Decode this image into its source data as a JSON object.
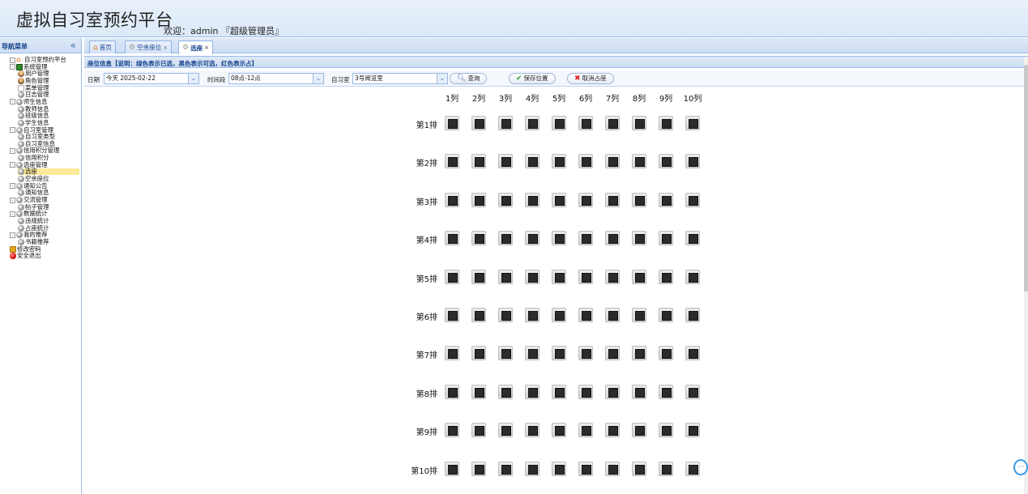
{
  "header": {
    "title": "虚拟自习室预约平台",
    "welcome": "欢迎：admin 『超级管理员』"
  },
  "sidebar": {
    "title": "导航菜单",
    "collapse_icon": "«",
    "items": [
      {
        "label": "自习室预约平台",
        "icon": "home-icon",
        "expander": "⊟"
      },
      {
        "label": "系统管理",
        "icon": "system-icon",
        "expander": "⊟"
      },
      {
        "label": "用户管理",
        "icon": "user-icon"
      },
      {
        "label": "角色管理",
        "icon": "role-icon"
      },
      {
        "label": "菜单管理",
        "icon": "menu-icon"
      },
      {
        "label": "日志管理",
        "icon": "gear-icon"
      },
      {
        "label": "师生信息",
        "icon": "gear-icon",
        "expander": "⊟"
      },
      {
        "label": "教师信息",
        "icon": "gear-icon"
      },
      {
        "label": "班级信息",
        "icon": "gear-icon"
      },
      {
        "label": "学生信息",
        "icon": "gear-icon"
      },
      {
        "label": "自习室管理",
        "icon": "gear-icon",
        "expander": "⊟"
      },
      {
        "label": "自习室类型",
        "icon": "gear-icon"
      },
      {
        "label": "自习室信息",
        "icon": "gear-icon"
      },
      {
        "label": "信用积分管理",
        "icon": "gear-icon",
        "expander": "⊟"
      },
      {
        "label": "信用积分",
        "icon": "gear-icon"
      },
      {
        "label": "选座管理",
        "icon": "gear-icon",
        "expander": "⊟"
      },
      {
        "label": "选座",
        "icon": "gear-icon",
        "selected": true
      },
      {
        "label": "空余座位",
        "icon": "gear-icon"
      },
      {
        "label": "通知公告",
        "icon": "gear-icon",
        "expander": "⊟"
      },
      {
        "label": "通知信息",
        "icon": "gear-icon"
      },
      {
        "label": "交流管理",
        "icon": "gear-icon",
        "expander": "⊟"
      },
      {
        "label": "帖子管理",
        "icon": "gear-icon"
      },
      {
        "label": "数据统计",
        "icon": "gear-icon",
        "expander": "⊟"
      },
      {
        "label": "违规统计",
        "icon": "gear-icon"
      },
      {
        "label": "占座统计",
        "icon": "gear-icon"
      },
      {
        "label": "我的推荐",
        "icon": "gear-icon",
        "expander": "⊟"
      },
      {
        "label": "书籍推荐",
        "icon": "gear-icon"
      },
      {
        "label": "修改密码",
        "icon": "lock-icon"
      },
      {
        "label": "安全退出",
        "icon": "exit-icon"
      }
    ]
  },
  "tabs": [
    {
      "label": "首页",
      "icon": "home-icon",
      "closable": false
    },
    {
      "label": "空余座位",
      "icon": "gear-icon",
      "closable": true
    },
    {
      "label": "选座",
      "icon": "gear-icon",
      "closable": true,
      "active": true
    }
  ],
  "tab_close_glyph": "×",
  "panel": {
    "title": "座位信息【说明：绿色表示已选，黑色表示可选，红色表示占】"
  },
  "toolbar": {
    "date_label": "日期",
    "date_value": "今天 2025-02-22",
    "time_label": "时间段",
    "time_value": "08点-12点",
    "room_label": "自习室",
    "room_value": "3号阅览室",
    "query_button": "查询",
    "save_button": "保存位置",
    "cancel_button": "取消占座"
  },
  "seat_grid": {
    "columns": [
      "1列",
      "2列",
      "3列",
      "4列",
      "5列",
      "6列",
      "7列",
      "8列",
      "9列",
      "10列"
    ],
    "rows": [
      "第1排",
      "第2排",
      "第3排",
      "第4排",
      "第5排",
      "第6排",
      "第7排",
      "第8排",
      "第9排",
      "第10排"
    ],
    "seat_state": "available"
  },
  "colors": {
    "header_bg": "#dce9f8",
    "border": "#99bbe8",
    "selected_row": "#fde99a",
    "seat_available": "#2b2b2b"
  }
}
